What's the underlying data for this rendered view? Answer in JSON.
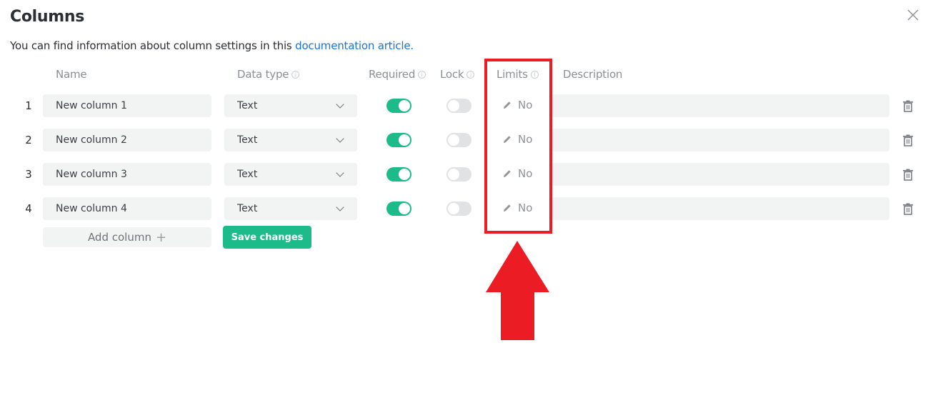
{
  "dialog": {
    "title": "Columns",
    "subtitle_prefix": "You can find information about column settings in this ",
    "subtitle_link": "documentation article."
  },
  "headers": {
    "name": "Name",
    "data_type": "Data type",
    "required": "Required",
    "lock": "Lock",
    "limits": "Limits",
    "description": "Description"
  },
  "rows": [
    {
      "num": "1",
      "name": "New column 1",
      "type": "Text",
      "required": true,
      "lock": false,
      "limits": "No",
      "description": ""
    },
    {
      "num": "2",
      "name": "New column 2",
      "type": "Text",
      "required": true,
      "lock": false,
      "limits": "No",
      "description": ""
    },
    {
      "num": "3",
      "name": "New column 3",
      "type": "Text",
      "required": true,
      "lock": false,
      "limits": "No",
      "description": ""
    },
    {
      "num": "4",
      "name": "New column 4",
      "type": "Text",
      "required": true,
      "lock": false,
      "limits": "No",
      "description": ""
    }
  ],
  "actions": {
    "add_column": "Add column",
    "add_icon": "+",
    "save_changes": "Save changes"
  },
  "icons": {
    "close": "close-icon",
    "info": "info-icon",
    "chevron": "chevron-down-icon",
    "edit": "pencil-icon",
    "delete": "trash-icon"
  },
  "colors": {
    "accent": "#1dbb8a",
    "link": "#1a73d9",
    "annotation": "#ec1c24",
    "toggle_off": "#e1e2e4",
    "field_bg": "#f2f3f3"
  }
}
